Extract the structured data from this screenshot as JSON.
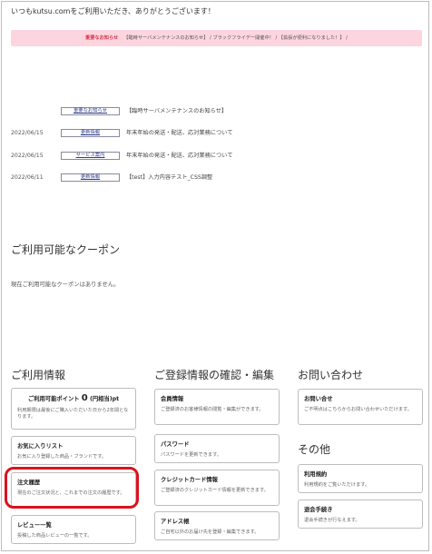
{
  "welcome_text": "いつもkutsu.comをご利用いただき、ありがとうございます！",
  "alert": {
    "tag": "重要なお知らせ",
    "text": "【臨時サーバメンテナンスのお知らせ】 / ブラックフライデー開催中！ / 【拡張が便利になりました！】 /"
  },
  "news": [
    {
      "date": "",
      "category": "重要なお知らせ",
      "title": "【臨時サーバメンテナンスのお知らせ】"
    },
    {
      "date": "2022/06/15",
      "category": "更新情報",
      "title": "年末年始の発送・配送、応対業務について"
    },
    {
      "date": "2022/06/15",
      "category": "サービス案内",
      "title": "年末年始の発送・配送、応対業務について"
    },
    {
      "date": "2022/06/11",
      "category": "更新情報",
      "title": "【test】入力内容テスト_CSS調整"
    }
  ],
  "coupon": {
    "heading": "ご利用可能なクーポン",
    "empty_text": "現在ご利用可能なクーポンはありません。"
  },
  "usage": {
    "heading": "ご利用情報",
    "points": {
      "label": "ご利用可能ポイント",
      "value": "0",
      "unit": "(円相当)pt",
      "desc": "利用期限は最後にご購入いただいた日から2年間となります。"
    },
    "favorites": {
      "title": "お気に入りリスト",
      "desc": "お気に入り登録した商品・ブランドです。"
    },
    "orders": {
      "title": "注文履歴",
      "desc": "現在のご注文状況と、これまでの注文の履歴です。"
    },
    "reviews": {
      "title": "レビュー一覧",
      "desc": "投稿した商品レビューの一覧です。"
    }
  },
  "registration": {
    "heading": "ご登録情報の確認・編集",
    "member": {
      "title": "会員情報",
      "desc": "ご登録済のお客様情報の閲覧・編集ができます。"
    },
    "password": {
      "title": "パスワード",
      "desc": "パスワードを更新できます。"
    },
    "credit": {
      "title": "クレジットカード情報",
      "desc": "ご登録済のクレジットカード情報を更新できます。"
    },
    "address": {
      "title": "アドレス帳",
      "desc": "ご自宅以外のお届け先を登録・編集できます。"
    }
  },
  "contact": {
    "heading": "お問い合わせ",
    "inquiry": {
      "title": "お問い合せ",
      "desc": "ご不明点はこちらからお問い合わせいただけます。"
    }
  },
  "other": {
    "heading": "その他",
    "terms": {
      "title": "利用規約",
      "desc": "利用規約をご覧いただけます。"
    },
    "withdraw": {
      "title": "退会手続き",
      "desc": "退会手続きが行なえます。"
    }
  },
  "colors": {
    "alert_bg": "#fdd5df",
    "highlight": "#d8131f",
    "link": "#2f3d8c"
  }
}
